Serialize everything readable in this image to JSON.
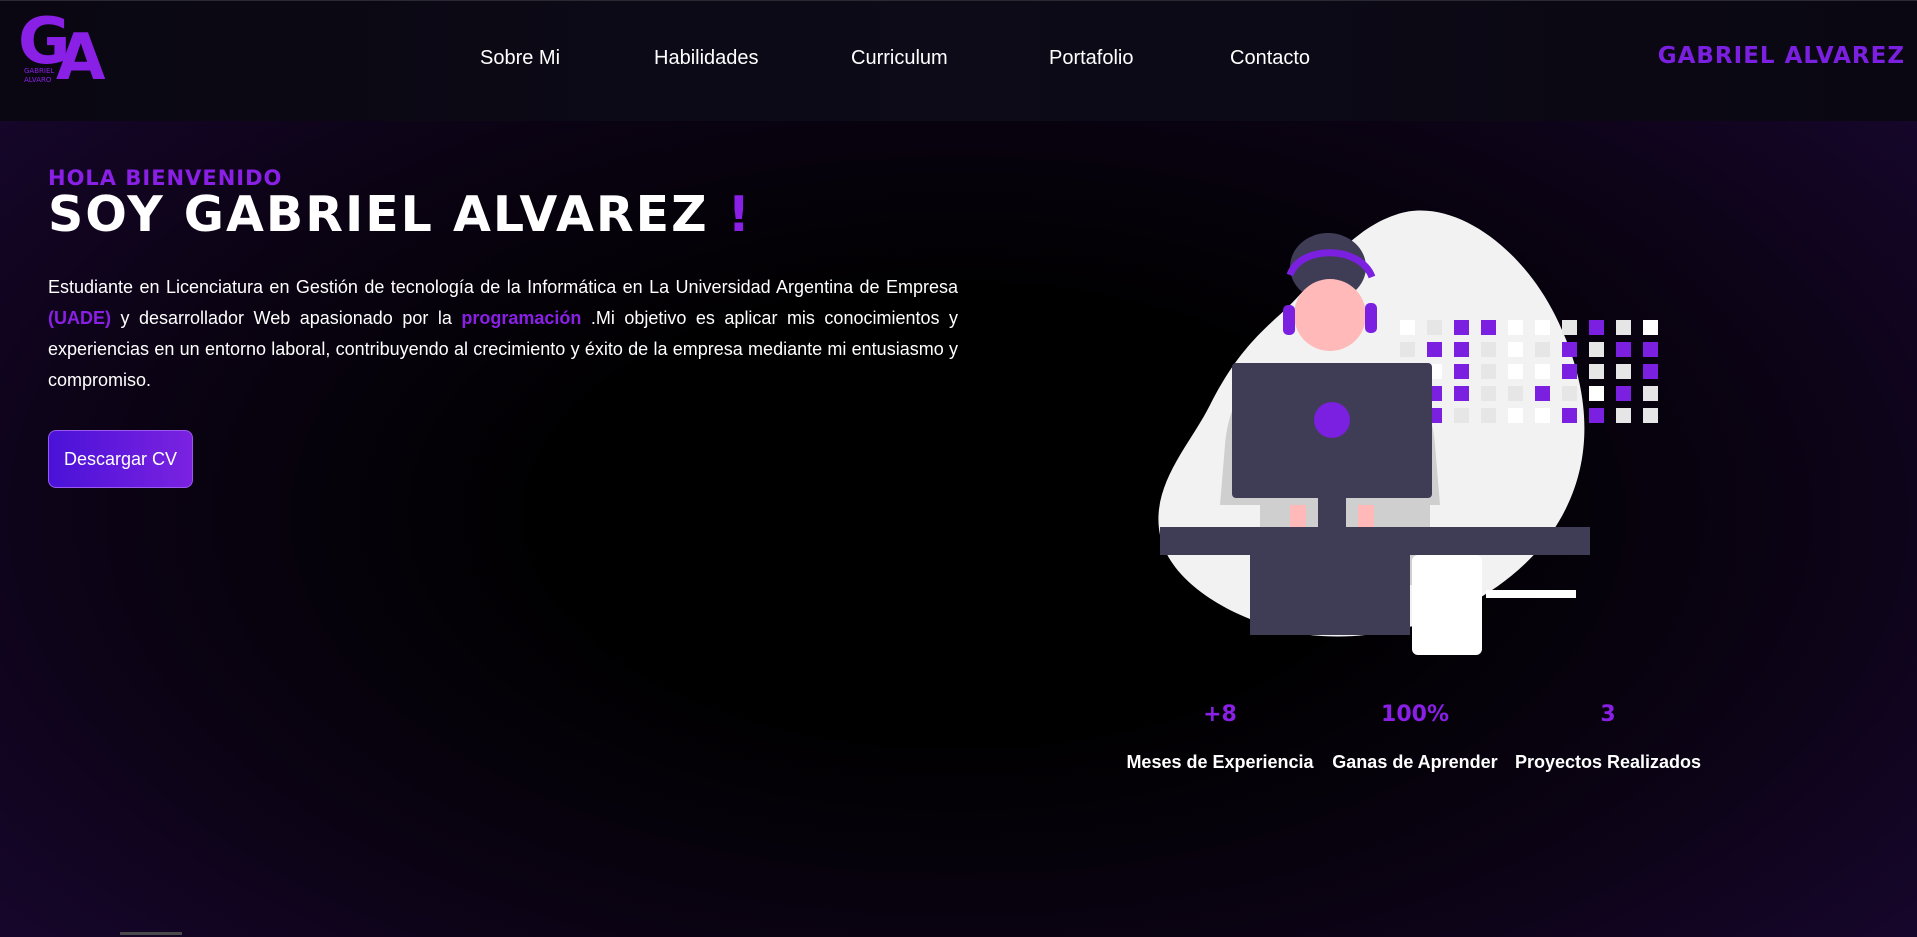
{
  "header": {
    "logo": {
      "initials_g": "G",
      "initials_a": "A",
      "small_text_line1": "GABRIEL",
      "small_text_line2": "ALVARO"
    },
    "nav": [
      {
        "label": "Sobre Mi"
      },
      {
        "label": "Habilidades"
      },
      {
        "label": "Curriculum"
      },
      {
        "label": "Portafolio"
      },
      {
        "label": "Contacto"
      }
    ],
    "brand_name": "Gabriel Alvarez"
  },
  "hero": {
    "greeting": "Hola Bienvenido",
    "title": "Soy Gabriel Alvarez",
    "title_mark": "!",
    "description": {
      "part1": "Estudiante en Licenciatura en Gestión de tecnología de la Informática en La Universidad Argentina de Empresa ",
      "highlight1": "(UADE)",
      "part2": " y desarrollador Web apasionado por la ",
      "highlight2": "programación",
      "part3": " .Mi objetivo es aplicar mis conocimientos y experiencias en un entorno laboral, contribuyendo al crecimiento y éxito de la empresa mediante mi entusiasmo y compromiso."
    },
    "cv_button": "Descargar CV"
  },
  "stats": [
    {
      "value": "+8",
      "label": "Meses de Experiencia"
    },
    {
      "value": "100%",
      "label": "Ganas de Aprender"
    },
    {
      "value": "3",
      "label": "Proyectos Realizados"
    }
  ],
  "colors": {
    "accent": "#8a1fe6",
    "button_start": "#4a12d8",
    "button_end": "#7b22e0",
    "header_bg": "#0b0914"
  }
}
